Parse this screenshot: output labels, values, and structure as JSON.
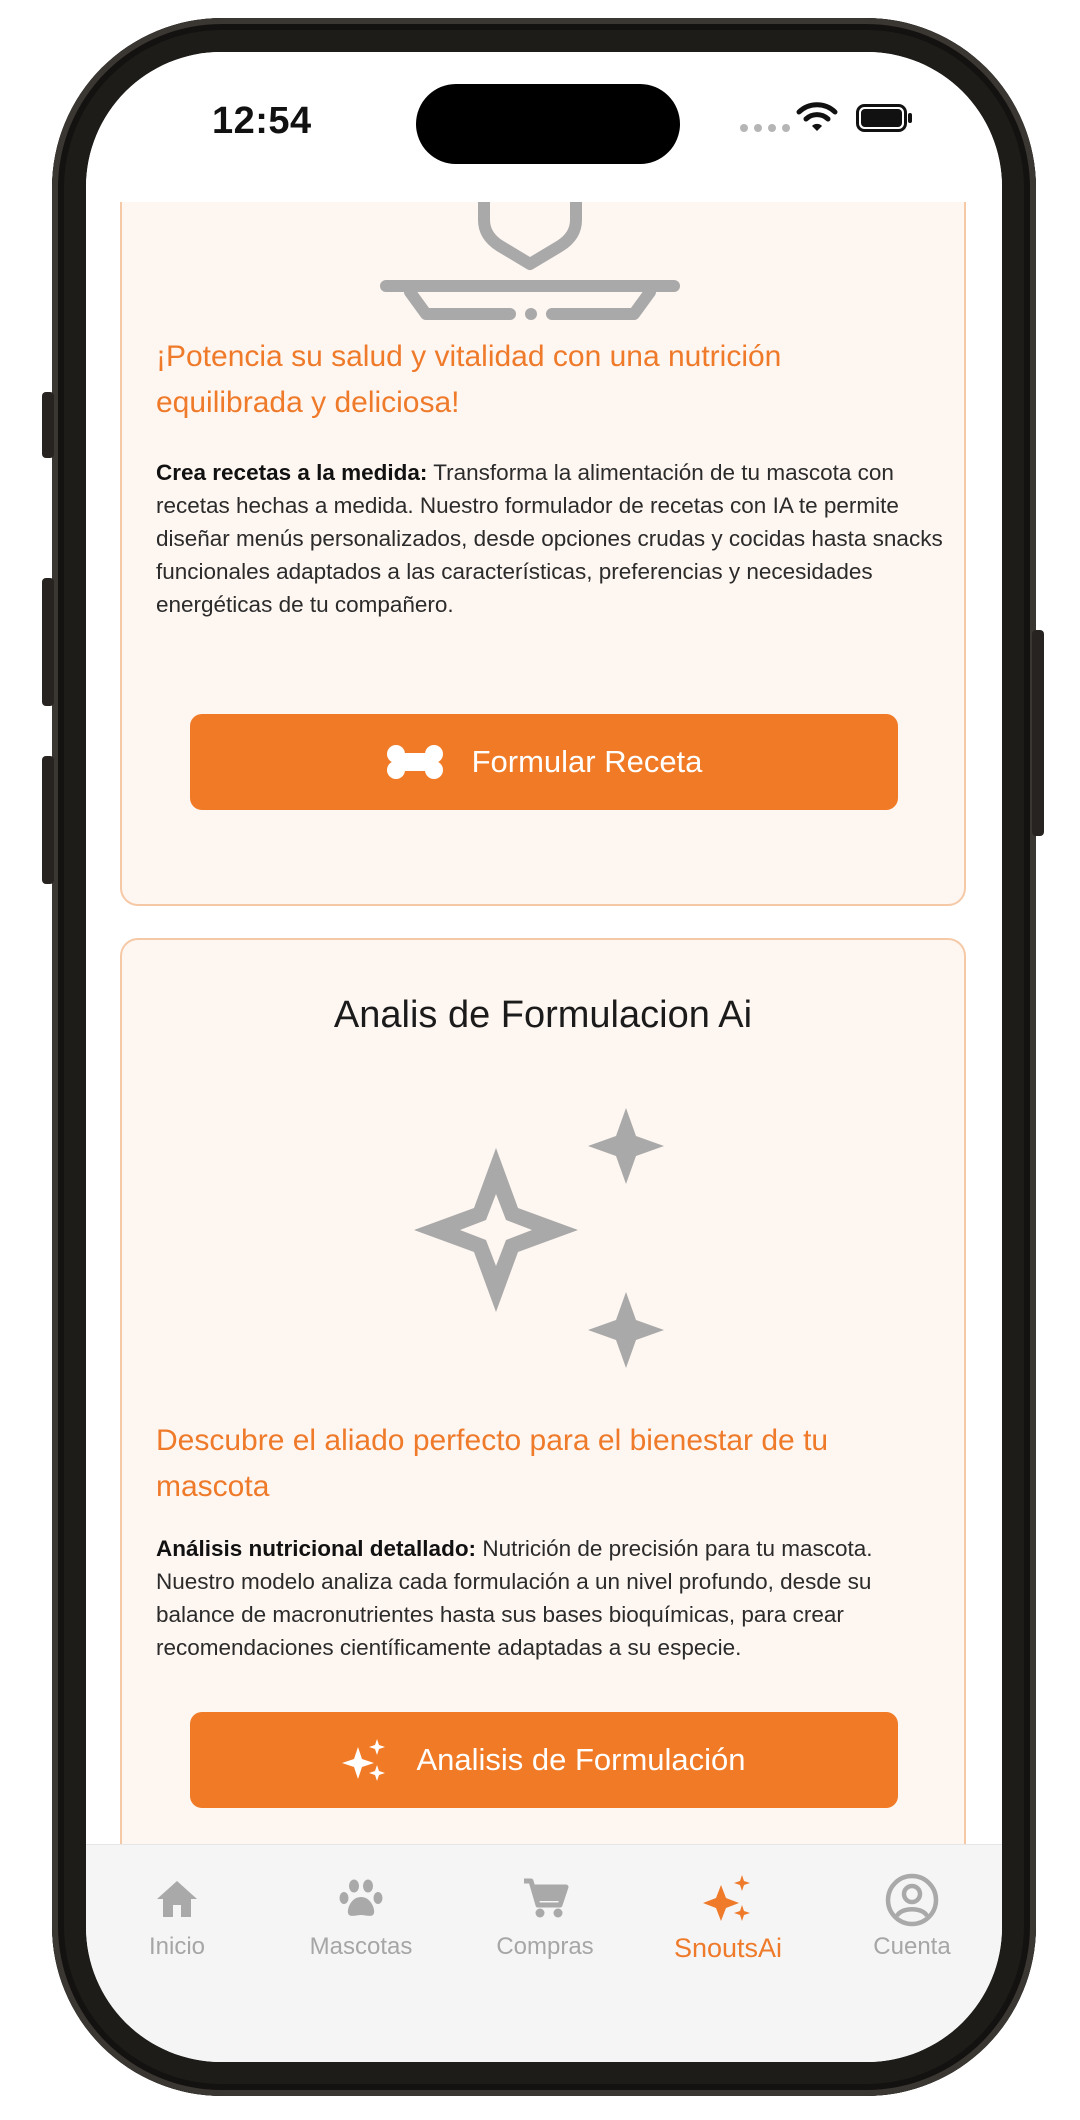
{
  "status_bar": {
    "time": "12:54"
  },
  "recipe_card": {
    "headline": "¡Potencia su salud y vitalidad con una nutrición equilibrada y deliciosa!",
    "body_bold": "Crea recetas a la medida:",
    "body_text": " Transforma la alimentación de tu mascota con recetas hechas a medida. Nuestro formulador de recetas con IA te permite diseñar menús personalizados, desde opciones crudas y cocidas hasta snacks funcionales adaptados a las características, preferencias y necesidades energéticas de tu compañero.",
    "button_label": "Formular Receta",
    "button_icon": "bone-icon"
  },
  "analysis_card": {
    "title": "Analis de Formulacion Ai",
    "headline": "Descubre el aliado perfecto para el bienestar de tu mascota",
    "body_bold": "Análisis nutricional detallado:",
    "body_text": " Nutrición de precisión para tu mascota. Nuestro modelo analiza cada formulación a un nivel profundo, desde su balance de macronutrientes hasta sus bases bioquímicas, para crear recomendaciones científicamente adaptadas a su especie.",
    "button_label": "Analisis de Formulación",
    "button_icon": "sparkles-icon"
  },
  "tab_bar": {
    "tabs": [
      {
        "label": "Inicio",
        "icon": "home-icon",
        "active": false
      },
      {
        "label": "Mascotas",
        "icon": "paw-icon",
        "active": false
      },
      {
        "label": "Compras",
        "icon": "cart-icon",
        "active": false
      },
      {
        "label": "SnoutsAi",
        "icon": "sparkles-icon",
        "active": true
      },
      {
        "label": "Cuenta",
        "icon": "account-icon",
        "active": false
      }
    ]
  },
  "colors": {
    "accent": "#f07a26",
    "headline": "#ee7a2a",
    "card_background": "#fef6f1",
    "card_border": "#f6c9a6",
    "inactive_tab": "#a6a6a6",
    "illustration_gray": "#a9a9a9"
  }
}
